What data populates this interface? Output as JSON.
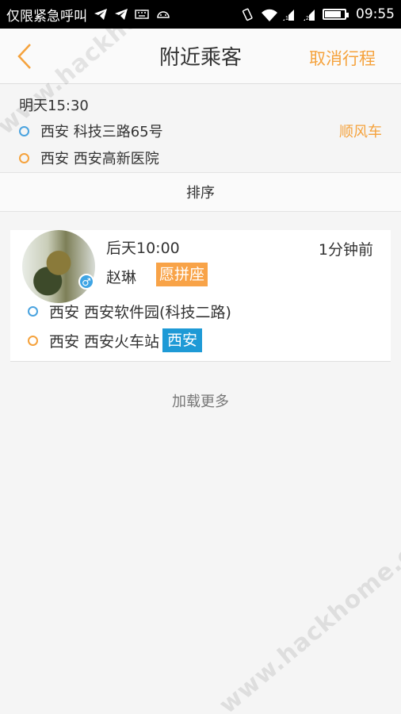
{
  "status_bar": {
    "left_text": "仅限紧急呼叫",
    "time": "09:55",
    "battery_fraction": 0.85,
    "icons": [
      "telegram-icon",
      "telegram-icon",
      "keyboard-icon",
      "android-icon",
      "vibrate-icon",
      "wifi-icon",
      "signal-icon",
      "signal-icon",
      "battery-icon"
    ]
  },
  "nav": {
    "title": "附近乘客",
    "back_icon": "chevron-left-icon",
    "action": "取消行程",
    "accent": "#f5a23c"
  },
  "trip": {
    "time": "明天15:30",
    "from": "西安 科技三路65号",
    "to": "西安 西安高新医院",
    "tag": "顺风车"
  },
  "sort": {
    "label": "排序"
  },
  "passengers": [
    {
      "time": "后天10:00",
      "ago": "1分钟前",
      "name": "赵琳",
      "badge": "愿拼座",
      "gender_icon": "male-icon",
      "from": "西安 西安软件园(科技二路)",
      "to": "西安 西安火车站",
      "city_badge": "西安"
    }
  ],
  "load_more": "加载更多",
  "watermark": "www.hackhome.com",
  "colors": {
    "origin_dot": "#4aa3df",
    "dest_dot": "#f5a23c",
    "badge_orange": "#f8a348",
    "badge_blue": "#1e9ad6"
  }
}
